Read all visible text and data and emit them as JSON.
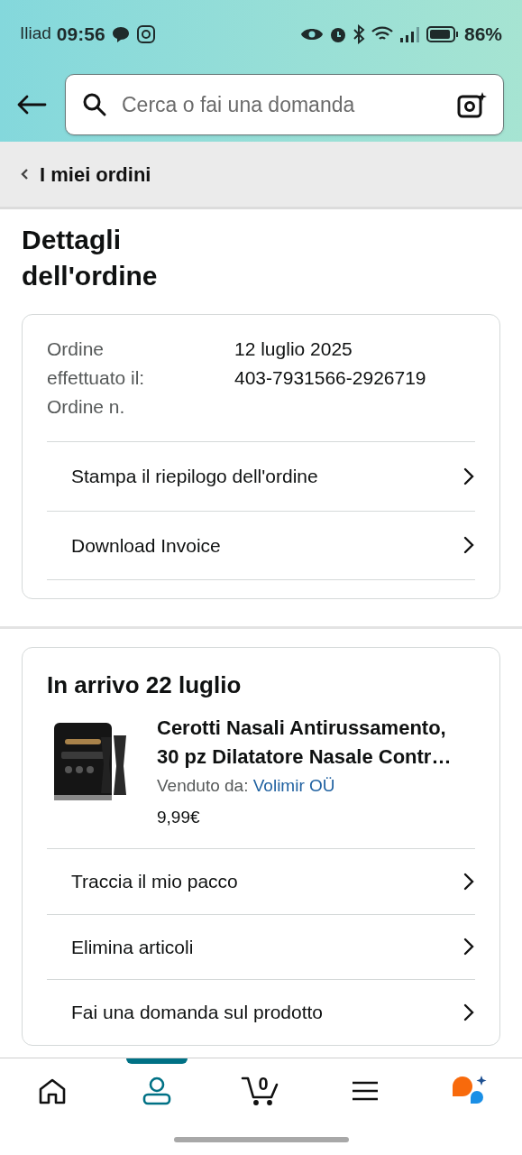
{
  "status_bar": {
    "carrier": "Iliad",
    "time": "09:56",
    "battery": "86%"
  },
  "search": {
    "placeholder": "Cerca o fai una domanda"
  },
  "breadcrumb": {
    "label": "I miei ordini"
  },
  "page_title": "Dettagli dell'ordine",
  "order_info": {
    "labels": [
      "Ordine effettuato il:",
      "Ordine n."
    ],
    "values": [
      "12 luglio 2025",
      "403-7931566-2926719"
    ]
  },
  "order_actions": [
    "Stampa il riepilogo dell'ordine",
    "Download Invoice"
  ],
  "shipment": {
    "title": "In arrivo 22 luglio",
    "product": {
      "kind": "picture",
      "name": "Cerotti Nasali Antirussamento, 30 pz Dilatatore Nasale Contr…",
      "seller_label": "Venduto da:",
      "seller": "Volimir OÜ",
      "price": "9,99€"
    },
    "actions": [
      "Traccia il mio pacco",
      "Elimina articoli",
      "Fai una domanda sul prodotto"
    ]
  },
  "bottom_nav": [
    {
      "kind": "home",
      "selected": false
    },
    {
      "kind": "account",
      "selected": true
    },
    {
      "kind": "cart",
      "selected": false,
      "count": "0"
    },
    {
      "kind": "menu",
      "selected": false
    },
    {
      "kind": "assistant",
      "selected": false
    }
  ]
}
